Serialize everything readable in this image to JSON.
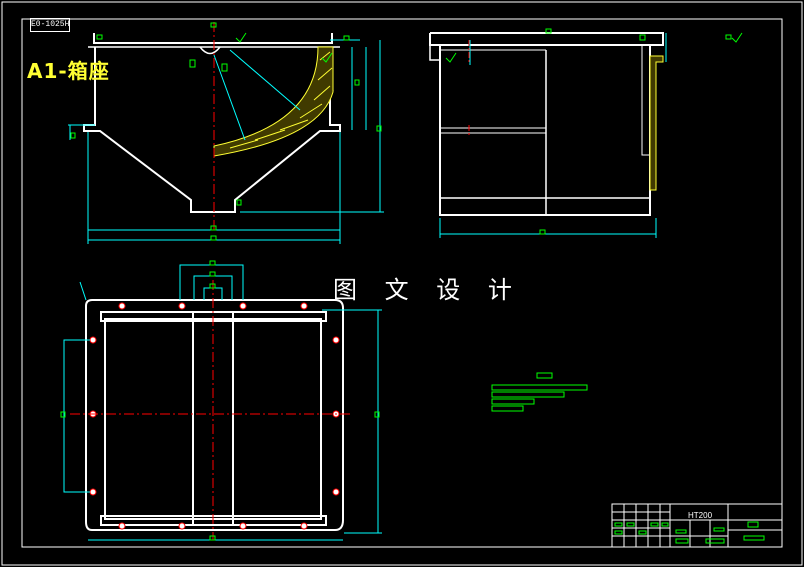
{
  "drawing": {
    "title_block_code": "E0-1025H",
    "part_title": "A1-箱座",
    "watermark": "图 文 设 计",
    "material": "HT200"
  },
  "colors": {
    "background": "#000000",
    "outline": "#ffffff",
    "dimension": "#00ffff",
    "annotation": "#00ff00",
    "centerline": "#ff0000",
    "section_hatch": "#ffff33"
  }
}
